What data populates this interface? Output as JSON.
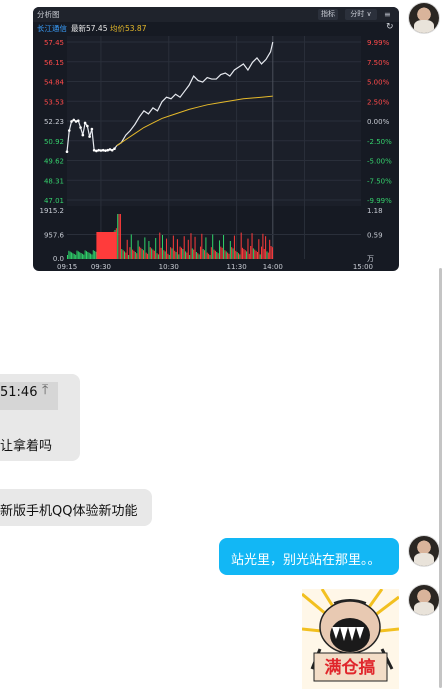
{
  "chart_card": {
    "title": "分析图",
    "btn_indicator": "指标",
    "btn_period": "分时",
    "stock_name": "长江通信",
    "latest_label": "最新57.45",
    "avg_label": "均价53.87",
    "left_ticks": [
      "57.45",
      "56.15",
      "54.84",
      "53.53",
      "52.23",
      "50.92",
      "49.62",
      "48.31",
      "47.01"
    ],
    "right_ticks": [
      "9.99%",
      "7.50%",
      "5.00%",
      "2.50%",
      "0.00%",
      "-2.50%",
      "-5.00%",
      "-7.50%",
      "-9.99%"
    ],
    "vol_left_ticks": [
      "1915.2",
      "957.6",
      "0.0"
    ],
    "vol_right_ticks": [
      "1.18",
      "0.59",
      "万"
    ],
    "time_ticks": [
      "09:15",
      "09:30",
      "10:30",
      "11:30",
      "14:00",
      "15:00"
    ],
    "colors": {
      "up": "#ff3b3b",
      "down": "#2fd36a",
      "price_line": "#e6e9ef",
      "avg_line": "#e5b92a",
      "bg": "#161a23"
    }
  },
  "chart_data": {
    "type": "line",
    "title": "",
    "ylim": [
      47.01,
      57.45
    ],
    "price": [
      [
        0,
        50.2
      ],
      [
        1,
        51.6
      ],
      [
        2,
        52.2
      ],
      [
        3,
        52.3
      ],
      [
        4,
        52.2
      ],
      [
        5,
        52.25
      ],
      [
        6,
        51.8
      ],
      [
        7,
        51.3
      ],
      [
        8,
        52.1
      ],
      [
        9,
        51.9
      ],
      [
        10,
        51.2
      ],
      [
        11,
        51.7
      ],
      [
        12,
        50.3
      ],
      [
        13,
        50.25
      ],
      [
        14,
        50.3
      ],
      [
        15,
        50.28
      ],
      [
        16,
        50.3
      ],
      [
        17,
        50.27
      ],
      [
        18,
        50.3
      ],
      [
        19,
        50.35
      ],
      [
        20,
        50.3
      ],
      [
        21,
        50.4
      ],
      [
        22,
        50.6
      ],
      [
        24,
        50.8
      ],
      [
        26,
        51.3
      ],
      [
        28,
        51.6
      ],
      [
        30,
        52.0
      ],
      [
        32,
        52.5
      ],
      [
        34,
        52.9
      ],
      [
        36,
        52.7
      ],
      [
        38,
        53.1
      ],
      [
        40,
        52.9
      ],
      [
        42,
        53.5
      ],
      [
        44,
        53.8
      ],
      [
        46,
        53.7
      ],
      [
        48,
        54.0
      ],
      [
        50,
        53.8
      ],
      [
        52,
        54.2
      ],
      [
        54,
        54.6
      ],
      [
        56,
        55.2
      ],
      [
        58,
        54.9
      ],
      [
        60,
        54.8
      ],
      [
        62,
        55.1
      ],
      [
        64,
        55.0
      ],
      [
        66,
        55.0
      ],
      [
        68,
        55.3
      ],
      [
        70,
        55.4
      ],
      [
        72,
        55.2
      ],
      [
        74,
        55.6
      ],
      [
        76,
        55.8
      ],
      [
        78,
        56.0
      ],
      [
        80,
        55.6
      ],
      [
        82,
        56.1
      ],
      [
        84,
        56.4
      ],
      [
        86,
        56.0
      ],
      [
        88,
        56.3
      ],
      [
        90,
        56.8
      ],
      [
        91,
        57.45
      ]
    ],
    "avg": [
      [
        22,
        50.6
      ],
      [
        26,
        51.0
      ],
      [
        30,
        51.4
      ],
      [
        34,
        51.8
      ],
      [
        38,
        52.1
      ],
      [
        42,
        52.4
      ],
      [
        46,
        52.6
      ],
      [
        50,
        52.8
      ],
      [
        54,
        53.0
      ],
      [
        58,
        53.15
      ],
      [
        62,
        53.3
      ],
      [
        66,
        53.4
      ],
      [
        70,
        53.5
      ],
      [
        74,
        53.6
      ],
      [
        78,
        53.7
      ],
      [
        82,
        53.75
      ],
      [
        86,
        53.8
      ],
      [
        91,
        53.87
      ]
    ],
    "x_range": [
      0,
      130
    ],
    "note_axis": "minutes index: 0=09:15, 15=09:30, 75=11:30/13:00, 91≈14:00, 130=15:00"
  },
  "messages": [
    {
      "side": "left",
      "time": "51:46",
      "text": "让拿着吗"
    },
    {
      "side": "left",
      "text": "新版手机QQ体验新功能"
    },
    {
      "side": "right",
      "text": "站光里，别光站在那里。。"
    },
    {
      "side": "right",
      "sticker_text": "满仓搞"
    }
  ]
}
